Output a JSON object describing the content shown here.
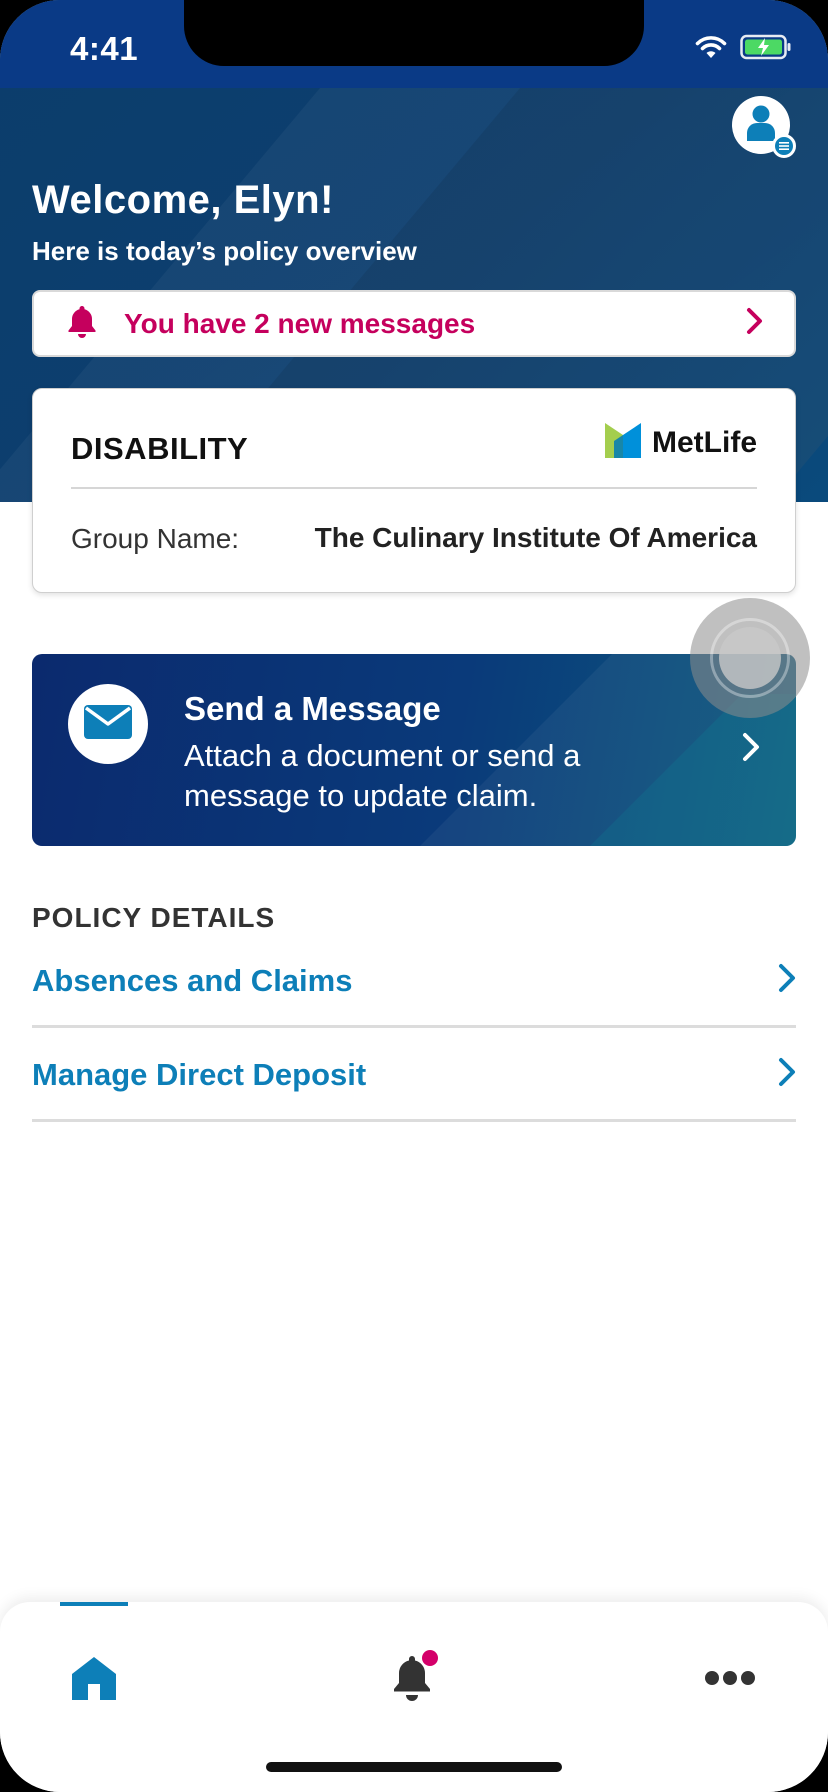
{
  "status_bar": {
    "time": "4:41"
  },
  "header": {
    "welcome": "Welcome, Elyn!",
    "subtitle": "Here is today’s policy overview"
  },
  "messages_banner": {
    "text": "You have 2 new messages"
  },
  "policy_card": {
    "policy_type": "DISABILITY",
    "carrier": "MetLife",
    "group_label": "Group Name:",
    "group_value": "The Culinary Institute Of America"
  },
  "send_message_card": {
    "title": "Send a Message",
    "description": "Attach a document or send a message to update claim."
  },
  "policy_details": {
    "section_title": "POLICY DETAILS",
    "items": [
      {
        "label": "Absences and Claims"
      },
      {
        "label": "Manage Direct Deposit"
      }
    ]
  },
  "bottom_nav": {
    "items": [
      {
        "icon": "home-icon",
        "active": true
      },
      {
        "icon": "bell-icon",
        "has_notification": true
      },
      {
        "icon": "more-icon"
      }
    ]
  },
  "colors": {
    "brand_navy": "#0c3d6b",
    "accent_blue": "#0d7fb8",
    "alert_magenta": "#c5005d",
    "metlife_green": "#a4ce4e"
  }
}
